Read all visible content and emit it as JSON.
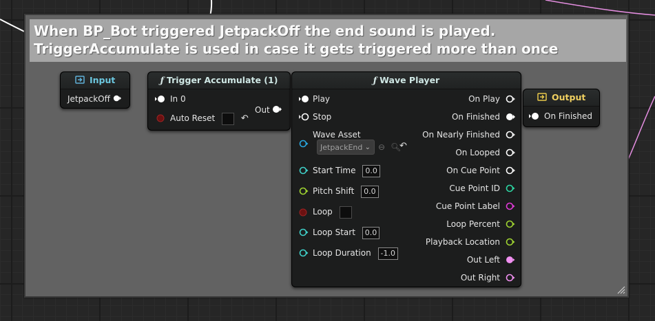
{
  "comment": {
    "line1": "When BP_Bot triggered JetpackOff the end sound is played.",
    "line2": "TriggerAccumulate is used in case it gets triggered more than once"
  },
  "input_node": {
    "title": "Input",
    "output_pin": "JetpackOff"
  },
  "trigger_node": {
    "title": "Trigger Accumulate (1)",
    "inputs": [
      "In 0",
      "Auto Reset"
    ],
    "output": "Out",
    "auto_reset_value": false
  },
  "wave_player_node": {
    "title": "Wave Player",
    "inputs": {
      "play": "Play",
      "stop": "Stop",
      "wave_asset": "Wave Asset",
      "wave_asset_value": "JetpackEnd",
      "start_time": "Start Time",
      "start_time_value": "0.0",
      "pitch_shift": "Pitch Shift",
      "pitch_shift_value": "0.0",
      "loop": "Loop",
      "loop_start": "Loop Start",
      "loop_start_value": "0.0",
      "loop_duration": "Loop Duration",
      "loop_duration_value": "-1.0"
    },
    "outputs": [
      "On Play",
      "On Finished",
      "On Nearly Finished",
      "On Looped",
      "On Cue Point",
      "Cue Point ID",
      "Cue Point Label",
      "Loop Percent",
      "Playback Location",
      "Out Left",
      "Out Right"
    ]
  },
  "output_node": {
    "title": "Output",
    "input_pin": "On Finished"
  },
  "colors": {
    "trigger_pin": "#ffffff",
    "float_pin": "#3fd0c8",
    "bool_pin": "#8c1d1d",
    "wave_pin": "#28a7e0",
    "int_pin": "#2dd7a3",
    "string_pin": "#e23ad9",
    "percent_pin": "#9fd431",
    "audio_pin": "#f090f0",
    "wire_white": "#ffffff",
    "wire_pink": "#e48ee0"
  }
}
